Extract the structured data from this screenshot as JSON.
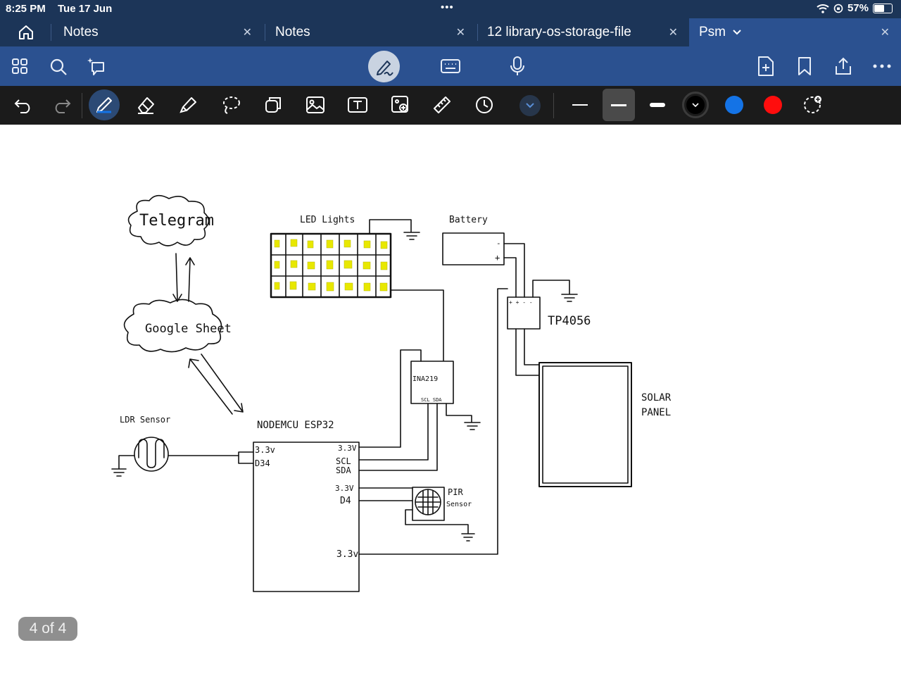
{
  "status": {
    "time": "8:25 PM",
    "date": "Tue 17 Jun",
    "multitask_dots": "•••",
    "battery_percent": "57%"
  },
  "tabs": [
    {
      "label": "Notes",
      "active": false
    },
    {
      "label": "Notes",
      "active": false
    },
    {
      "label": "12 library-os-storage-file",
      "active": false
    },
    {
      "label": "Psm",
      "active": true
    }
  ],
  "toolbar": {
    "top_icons": [
      "home-icon",
      "grid-icon",
      "search-icon",
      "ai-lasso-icon",
      "pen-mode-icon",
      "keyboard-icon",
      "microphone-icon",
      "add-page-icon",
      "bookmark-icon",
      "share-icon",
      "more-icon"
    ],
    "tool_icons": [
      "undo-icon",
      "redo-icon",
      "pen-icon",
      "eraser-icon",
      "highlighter-icon",
      "lasso-icon",
      "shapes-icon",
      "image-icon",
      "text-icon",
      "camera-icon",
      "ruler-icon",
      "timer-icon",
      "expand-icon"
    ],
    "colors": {
      "black": "#000000",
      "blue": "#1473e6",
      "red": "#ff0d0d"
    }
  },
  "diagram": {
    "telegram": "Telegram",
    "google_sheet": "Google Sheet",
    "led_lights": "LED Lights",
    "battery": "Battery",
    "battery_minus": "-",
    "battery_plus": "+",
    "tp4056": "TP4056",
    "tp_pins": "+ + - -",
    "solar_line1": "SOLAR",
    "solar_line2": "PANEL",
    "ina219": "INA219",
    "ina_pins": "SCL SDA",
    "ldr_sensor": "LDR Sensor",
    "nodemcu": "NODEMCU  ESP32",
    "pin_33v_left": "3.3v",
    "pin_d34": "D34",
    "pin_33v_r1": "3.3V",
    "pin_scl": "SCL",
    "pin_sda": "SDA",
    "pin_33v_r2": "3.3V",
    "pin_d4": "D4",
    "pin_33v_r3": "3.3v",
    "pir_line1": "PIR",
    "pir_line2": "Sensor"
  },
  "page_indicator": "4 of 4"
}
